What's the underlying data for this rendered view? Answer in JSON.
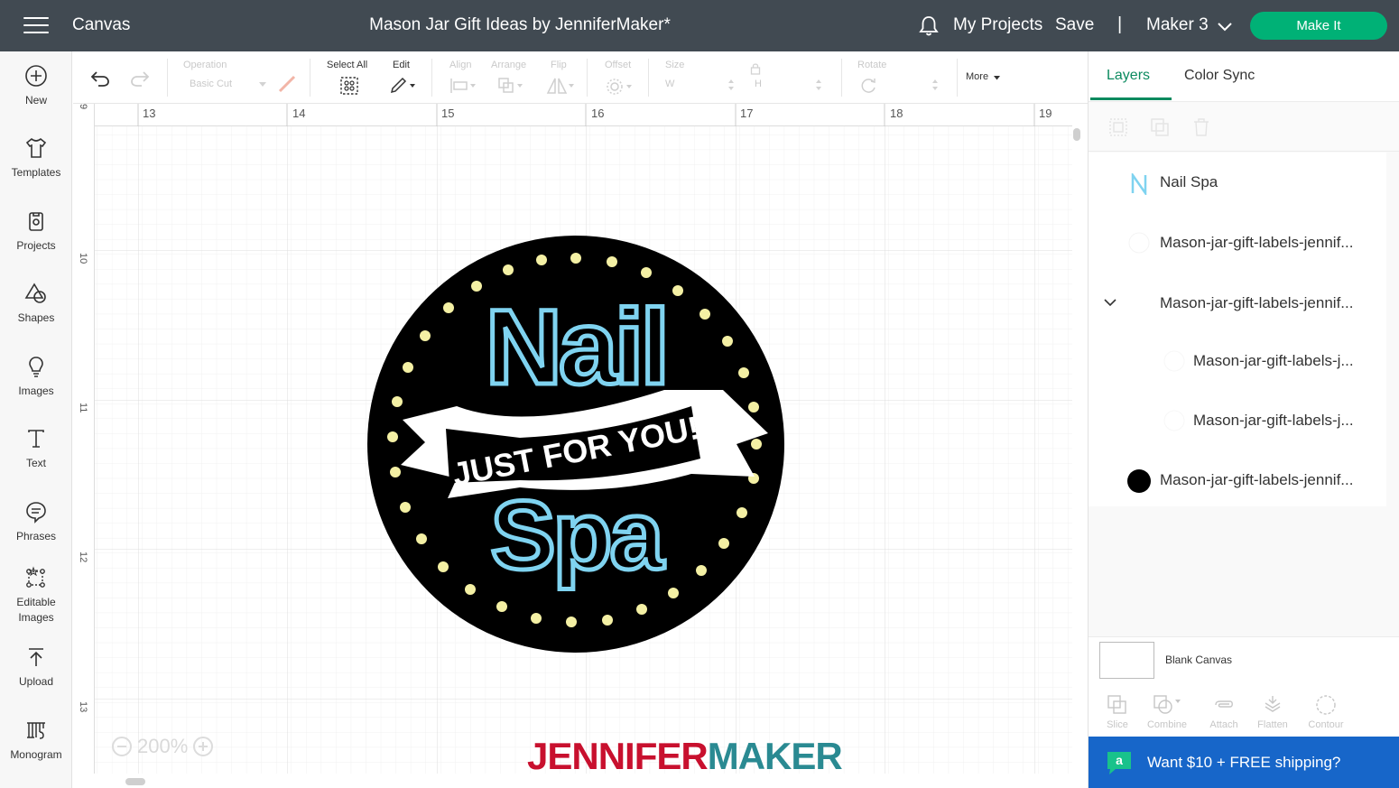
{
  "topbar": {
    "app_title": "Canvas",
    "project_title": "Mason Jar Gift Ideas by JenniferMaker*",
    "my_projects": "My Projects",
    "save": "Save",
    "separator": "|",
    "machine": "Maker 3",
    "make_it": "Make It"
  },
  "sidebar": {
    "items": [
      {
        "label": "New",
        "icon": "plus-circle-icon"
      },
      {
        "label": "Templates",
        "icon": "tshirt-icon"
      },
      {
        "label": "Projects",
        "icon": "projects-icon"
      },
      {
        "label": "Shapes",
        "icon": "shapes-icon"
      },
      {
        "label": "Images",
        "icon": "lightbulb-icon"
      },
      {
        "label": "Text",
        "icon": "text-icon"
      },
      {
        "label": "Phrases",
        "icon": "speech-bubble-icon"
      },
      {
        "label": "Editable\nImages",
        "label_line1": "Editable",
        "label_line2": "Images",
        "icon": "editable-images-icon"
      },
      {
        "label": "Upload",
        "icon": "upload-icon"
      },
      {
        "label": "Monogram",
        "icon": "monogram-icon"
      }
    ]
  },
  "toolbar": {
    "operation_label": "Operation",
    "operation_value": "Basic Cut",
    "select_all_label": "Select All",
    "edit_label": "Edit",
    "align_label": "Align",
    "arrange_label": "Arrange",
    "flip_label": "Flip",
    "offset_label": "Offset",
    "size_label": "Size",
    "size_w": "W",
    "size_h": "H",
    "rotate_label": "Rotate",
    "more_label": "More"
  },
  "canvas": {
    "ruler_top": [
      "13",
      "14",
      "15",
      "16",
      "17",
      "18",
      "19"
    ],
    "ruler_left": [
      "9",
      "10",
      "11",
      "12",
      "13"
    ],
    "zoom": "200%",
    "design": {
      "line1": "Nail",
      "line2": "Spa",
      "banner": "JUST FOR YOU!"
    },
    "watermark_part1": "JENNIFER",
    "watermark_part2": "MAKER"
  },
  "right_panel": {
    "tabs": [
      {
        "label": "Layers",
        "active": true
      },
      {
        "label": "Color Sync",
        "active": false
      }
    ],
    "layers": [
      {
        "name": "Nail Spa",
        "icon": "text-layer-icon",
        "indent": 0
      },
      {
        "name": "Mason-jar-gift-labels-jennif...",
        "icon": "blank-layer-icon",
        "indent": 0
      },
      {
        "name": "Mason-jar-gift-labels-jennif...",
        "icon": "chevron-down-icon",
        "indent": 0
      },
      {
        "name": "Mason-jar-gift-labels-j...",
        "icon": "blank-layer-icon",
        "indent": 1
      },
      {
        "name": "Mason-jar-gift-labels-j...",
        "icon": "blank-layer-icon",
        "indent": 1
      },
      {
        "name": "Mason-jar-gift-labels-jennif...",
        "icon": "black-circle-icon",
        "indent": 0
      }
    ],
    "blank_canvas": "Blank Canvas",
    "bottom_tools": [
      "Slice",
      "Combine",
      "Attach",
      "Flatten",
      "Contour"
    ]
  },
  "promo": {
    "text": "Want $10 + FREE shipping?"
  },
  "colors": {
    "topbar": "#414a52",
    "make_it": "#00b176",
    "accent_green": "#0b8a5f",
    "promo_blue": "#1766c9",
    "nail_spa_blue": "#7fd3f0",
    "dot_yellow": "#f4f0a4",
    "watermark_red": "#c8102e",
    "watermark_teal": "#2a8a92"
  }
}
